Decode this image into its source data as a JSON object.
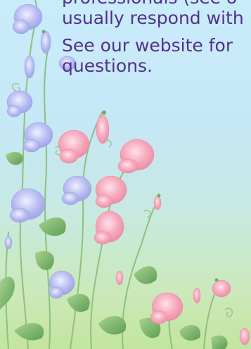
{
  "content": {
    "paragraphs": [
      "professionals (see o",
      "usually respond with",
      "See our website for",
      "questions."
    ]
  },
  "colors": {
    "text": "#54308c",
    "background_top": "#c9ecfb",
    "background_bottom": "#c2e59f",
    "pink_flower": "#f7a8bc",
    "blue_flower": "#b5b8f0",
    "leaf": "#79b36a",
    "stem": "#8fc07e"
  }
}
